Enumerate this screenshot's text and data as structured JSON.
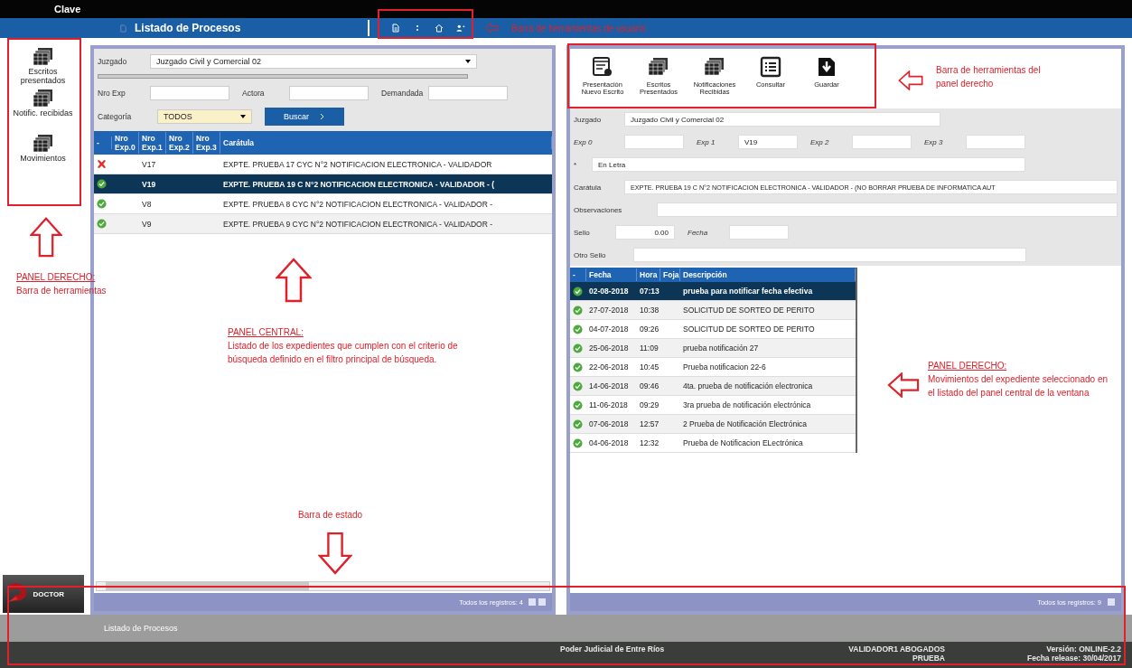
{
  "window": {
    "top_label": "Clave",
    "title": "Listado de Procesos"
  },
  "user_toolbar": [
    {
      "kind": "document"
    },
    {
      "kind": "dots"
    },
    {
      "kind": "home"
    },
    {
      "kind": "user"
    }
  ],
  "sidebar": {
    "items": [
      {
        "label": "Escritos presentados"
      },
      {
        "label": "Notific. recibidas"
      },
      {
        "label": "Movimientos"
      }
    ],
    "logo": "DOCTOR"
  },
  "filters": {
    "juzgado_label": "Juzgado",
    "juzgado_value": "Juzgado Civil y Comercial 02",
    "nro_exp_label": "Nro Exp",
    "actora_label": "Actora",
    "demandada_label": "Demandada",
    "categoria_label": "Categoría",
    "categoria_value": "TODOS",
    "search_button": "Buscar"
  },
  "processes": {
    "columns": [
      "-",
      "Nro Exp.0",
      "Nro Exp.1",
      "Nro Exp.2",
      "Nro Exp.3",
      "Carátula"
    ],
    "rows": [
      {
        "kind": "error",
        "exp1": "V17",
        "caratula": "EXPTE. PRUEBA 17 CYC N°2 NOTIFICACION ELECTRONICA - VALIDADOR",
        "selected": false
      },
      {
        "kind": "ok",
        "exp1": "V19",
        "caratula": "EXPTE. PRUEBA 19 C N°2 NOTIFICACION ELECTRONICA - VALIDADOR - (",
        "selected": true
      },
      {
        "kind": "ok",
        "exp1": "V8",
        "caratula": "EXPTE. PRUEBA 8 CYC N°2 NOTIFICACION ELECTRONICA - VALIDADOR -",
        "selected": false
      },
      {
        "kind": "ok",
        "exp1": "V9",
        "caratula": "EXPTE. PRUEBA 9 CYC N°2 NOTIFICACION ELECTRONICA - VALIDADOR -",
        "selected": false
      }
    ],
    "footer": "Todos los registros: 4"
  },
  "right_toolbar": [
    {
      "label": "Presentación Nuevo Escrito",
      "kind": "new-document"
    },
    {
      "label": "Escritos Presentados",
      "kind": "grid"
    },
    {
      "label": "Notificaciones Recibidas",
      "kind": "grid"
    },
    {
      "label": "Consultar",
      "kind": "list"
    },
    {
      "label": "Guardar",
      "kind": "save"
    }
  ],
  "detail_form": {
    "juzgado_label": "Juzgado",
    "juzgado_value": "Juzgado Civil y Comercial 02",
    "exp0_label": "Exp 0",
    "exp1_label": "Exp 1",
    "exp1_value": "V19",
    "exp2_label": "Exp 2",
    "exp3_label": "Exp 3",
    "letra_label": "*",
    "letra_value": "En Letra",
    "caratula_label": "Carátula",
    "caratula_value": "EXPTE. PRUEBA 19 C N°2 NOTIFICACION ELECTRONICA - VALIDADOR - (NO BORRAR PRUEBA DE INFORMATICA AUT",
    "observaciones_label": "Observaciones",
    "sello_label": "Sello",
    "sello_value": "0.00",
    "fecha_label": "Fecha",
    "otro_sello_label": "Otro Sello"
  },
  "movements": {
    "columns": [
      "-",
      "Fecha",
      "Hora",
      "Foja",
      "Descripción"
    ],
    "rows": [
      {
        "fecha": "02-08-2018",
        "hora": "07:13",
        "descripcion": "prueba para notificar fecha efectiva",
        "selected": true
      },
      {
        "fecha": "27-07-2018",
        "hora": "10:38",
        "descripcion": "SOLICITUD DE SORTEO DE PERITO",
        "selected": false
      },
      {
        "fecha": "04-07-2018",
        "hora": "09:26",
        "descripcion": "SOLICITUD DE SORTEO DE PERITO",
        "selected": false
      },
      {
        "fecha": "25-06-2018",
        "hora": "11:09",
        "descripcion": "prueba notificación 27",
        "selected": false
      },
      {
        "fecha": "22-06-2018",
        "hora": "10:45",
        "descripcion": "Prueba notificacion 22-6",
        "selected": false
      },
      {
        "fecha": "14-06-2018",
        "hora": "09:46",
        "descripcion": "4ta. prueba de notificación electronica",
        "selected": false
      },
      {
        "fecha": "11-06-2018",
        "hora": "09:29",
        "descripcion": "3ra prueba de notificación electrónica",
        "selected": false
      },
      {
        "fecha": "07-06-2018",
        "hora": "12:57",
        "descripcion": "2 Prueba de Notificación Electrónica",
        "selected": false
      },
      {
        "fecha": "04-06-2018",
        "hora": "12:32",
        "descripcion": "Prueba de Notificacion ELectrónica",
        "selected": false
      }
    ],
    "footer": "Todos los registros: 9"
  },
  "footer_label": "Listado de Procesos",
  "status_bar": {
    "organization": "Poder Judicial de Entre Ríos",
    "user": "VALIDADOR1 ABOGADOS",
    "role": "PRUEBA",
    "version": "Versión: ONLINE-2.2",
    "release": "Fecha release: 30/04/2017"
  },
  "annotations": [
    {
      "kind": "user-toolbar",
      "text": "Barra de herramientas de usuario"
    },
    {
      "kind": "sidebar",
      "heading": "PANEL DERECHO:",
      "text": "Barra de herramientas"
    },
    {
      "kind": "central",
      "heading": "PANEL CENTRAL:",
      "text": "Listado de los expedientes que cumplen con el criterio de búsqueda definido en el filtro principal de búsqueda."
    },
    {
      "kind": "status",
      "text": "Barra de estado"
    },
    {
      "kind": "right-toolbar",
      "text": "Barra de herramientas del panel derecho"
    },
    {
      "kind": "right-panel",
      "heading": "PANEL DERECHO:",
      "text": "Movimientos del expediente seleccionado en el listado del panel central de la ventana"
    }
  ]
}
